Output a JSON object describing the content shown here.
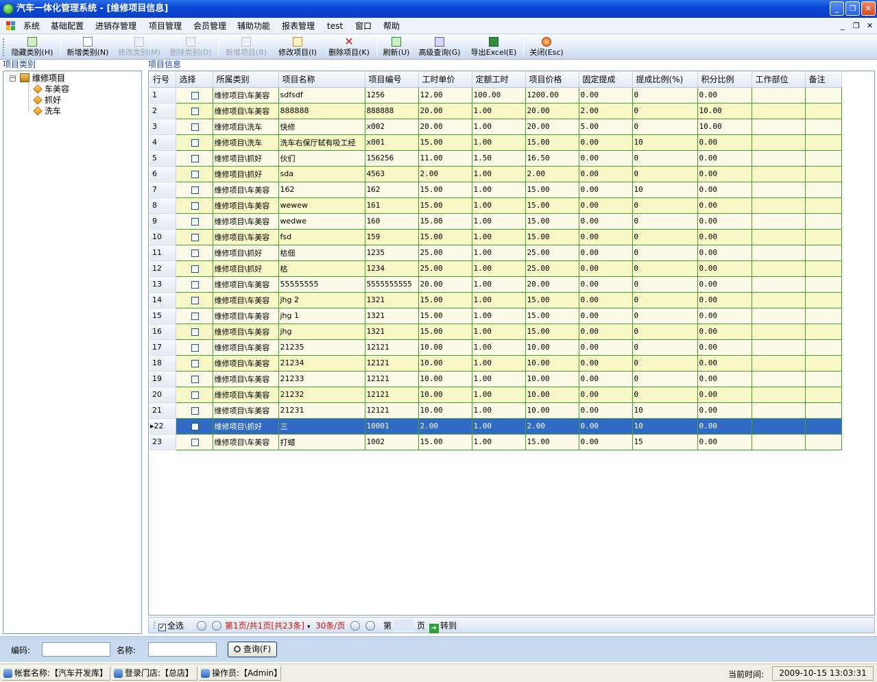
{
  "title_bar": {
    "title": "汽车一体化管理系统 - [维修项目信息]"
  },
  "menu": {
    "items": [
      "系统",
      "基础配置",
      "进销存管理",
      "项目管理",
      "会员管理",
      "辅助功能",
      "报表管理",
      "test",
      "窗口",
      "帮助"
    ]
  },
  "toolbar": {
    "hide_category": "隐藏类别(H)",
    "add_category": "新增类别(N)",
    "edit_category": "修改类别(M)",
    "delete_category": "删除类别(D)",
    "add_item": "新增项目(B)",
    "edit_item": "修改项目(I)",
    "delete_item": "删除项目(K)",
    "refresh": "刷新(U)",
    "advanced_query": "高级查询(G)",
    "export_excel": "导出Excel(E)",
    "close": "关闭(Esc)"
  },
  "left_panel": {
    "label": "项目类别",
    "root": "维修项目",
    "children": [
      "车美容",
      "抓好",
      "洗车"
    ]
  },
  "right_panel": {
    "label": "项目信息"
  },
  "grid": {
    "columns": [
      "行号",
      "选择",
      "所属类别",
      "项目名称",
      "项目编号",
      "工时单价",
      "定额工时",
      "项目价格",
      "固定提成",
      "提成比例(%)",
      "积分比例",
      "工作部位",
      "备注"
    ],
    "selected_row": 22,
    "rows": [
      [
        "1",
        "",
        "维修项目\\车美容",
        "sdfsdf",
        "1256",
        "12.00",
        "100.00",
        "1200.00",
        "0.00",
        "0",
        "0.00",
        "",
        ""
      ],
      [
        "2",
        "",
        "维修项目\\车美容",
        "888888",
        "888888",
        "20.00",
        "1.00",
        "20.00",
        "2.00",
        "0",
        "10.00",
        "",
        ""
      ],
      [
        "3",
        "",
        "维修项目\\洗车",
        "快修",
        "x002",
        "20.00",
        "1.00",
        "20.00",
        "5.00",
        "0",
        "10.00",
        "",
        ""
      ],
      [
        "4",
        "",
        "维修项目\\洗车",
        "洗车右保厅轼有吸工经",
        "x001",
        "15.00",
        "1.00",
        "15.00",
        "0.00",
        "10",
        "0.00",
        "",
        ""
      ],
      [
        "5",
        "",
        "维修项目\\抓好",
        "伙们",
        "156256",
        "11.00",
        "1.50",
        "16.50",
        "0.00",
        "0",
        "0.00",
        "",
        ""
      ],
      [
        "6",
        "",
        "维修项目\\抓好",
        "sda",
        "4563",
        "2.00",
        "1.00",
        "2.00",
        "0.00",
        "0",
        "0.00",
        "",
        ""
      ],
      [
        "7",
        "",
        "维修项目\\车美容",
        "162",
        "162",
        "15.00",
        "1.00",
        "15.00",
        "0.00",
        "10",
        "0.00",
        "",
        ""
      ],
      [
        "8",
        "",
        "维修项目\\车美容",
        "wewew",
        "161",
        "15.00",
        "1.00",
        "15.00",
        "0.00",
        "0",
        "0.00",
        "",
        ""
      ],
      [
        "9",
        "",
        "维修项目\\车美容",
        "wedwe",
        "160",
        "15.00",
        "1.00",
        "15.00",
        "0.00",
        "0",
        "0.00",
        "",
        ""
      ],
      [
        "10",
        "",
        "维修项目\\车美容",
        "fsd",
        "159",
        "15.00",
        "1.00",
        "15.00",
        "0.00",
        "0",
        "0.00",
        "",
        ""
      ],
      [
        "11",
        "",
        "维修项目\\抓好",
        "枯佃",
        "1235",
        "25.00",
        "1.00",
        "25.00",
        "0.00",
        "0",
        "0.00",
        "",
        ""
      ],
      [
        "12",
        "",
        "维修项目\\抓好",
        "枯",
        "1234",
        "25.00",
        "1.00",
        "25.00",
        "0.00",
        "0",
        "0.00",
        "",
        ""
      ],
      [
        "13",
        "",
        "维修项目\\车美容",
        "55555555",
        "5555555555",
        "20.00",
        "1.00",
        "20.00",
        "0.00",
        "0",
        "0.00",
        "",
        ""
      ],
      [
        "14",
        "",
        "维修项目\\车美容",
        "jhg 2",
        "1321",
        "15.00",
        "1.00",
        "15.00",
        "0.00",
        "0",
        "0.00",
        "",
        ""
      ],
      [
        "15",
        "",
        "维修项目\\车美容",
        "jhg 1",
        "1321",
        "15.00",
        "1.00",
        "15.00",
        "0.00",
        "0",
        "0.00",
        "",
        ""
      ],
      [
        "16",
        "",
        "维修项目\\车美容",
        "jhg",
        "1321",
        "15.00",
        "1.00",
        "15.00",
        "0.00",
        "0",
        "0.00",
        "",
        ""
      ],
      [
        "17",
        "",
        "维修项目\\车美容",
        "21235",
        "12121",
        "10.00",
        "1.00",
        "10.00",
        "0.00",
        "0",
        "0.00",
        "",
        ""
      ],
      [
        "18",
        "",
        "维修项目\\车美容",
        "21234",
        "12121",
        "10.00",
        "1.00",
        "10.00",
        "0.00",
        "0",
        "0.00",
        "",
        ""
      ],
      [
        "19",
        "",
        "维修项目\\车美容",
        "21233",
        "12121",
        "10.00",
        "1.00",
        "10.00",
        "0.00",
        "0",
        "0.00",
        "",
        ""
      ],
      [
        "20",
        "",
        "维修项目\\车美容",
        "21232",
        "12121",
        "10.00",
        "1.00",
        "10.00",
        "0.00",
        "0",
        "0.00",
        "",
        ""
      ],
      [
        "21",
        "",
        "维修项目\\车美容",
        "21231",
        "12121",
        "10.00",
        "1.00",
        "10.00",
        "0.00",
        "10",
        "0.00",
        "",
        ""
      ],
      [
        "22",
        "",
        "维修项目\\抓好",
        "三",
        "10001",
        "2.00",
        "1.00",
        "2.00",
        "0.00",
        "10",
        "0.00",
        "",
        ""
      ],
      [
        "23",
        "",
        "维修项目\\车美容",
        "打蜡",
        "1002",
        "15.00",
        "1.00",
        "15.00",
        "0.00",
        "15",
        "0.00",
        "",
        ""
      ]
    ]
  },
  "pager": {
    "select_all": "全选",
    "page_info": "第1页/共1页[共23条]",
    "per_page": "30条/页",
    "page_prefix": "第",
    "page_suffix": "页",
    "goto": "转到"
  },
  "search": {
    "code_label": "编码:",
    "name_label": "名称:",
    "query_button": "查询(F)",
    "code_value": "",
    "name_value": ""
  },
  "status": {
    "account": "帐套名称:【汽车开发库】",
    "store": "登录门店:【总店】",
    "operator": "操作员:【Admin】",
    "time_label": "当前时间:",
    "time_value": "2009-10-15 13:03:31"
  }
}
